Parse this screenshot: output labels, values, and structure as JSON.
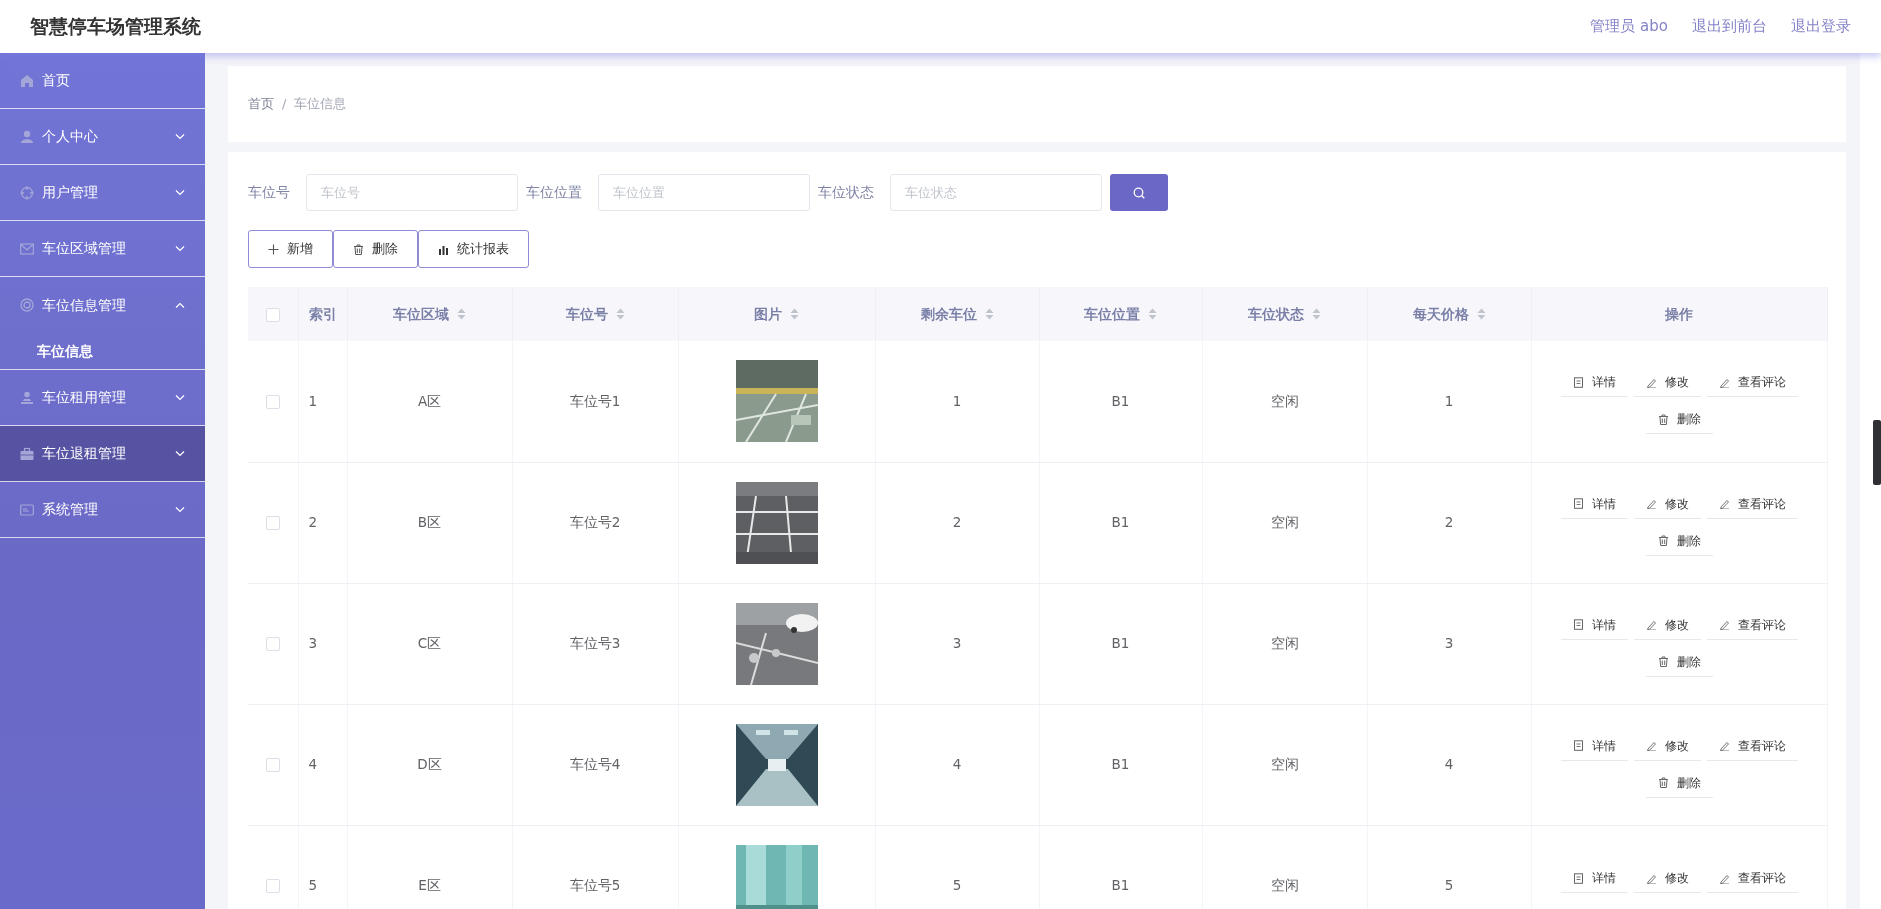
{
  "header": {
    "title": "智慧停车场管理系统",
    "links": [
      "管理员 abo",
      "退出到前台",
      "退出登录"
    ]
  },
  "sidebar": {
    "items": [
      {
        "label": "首页",
        "kind": "link",
        "hovered": false
      },
      {
        "label": "个人中心",
        "kind": "menu",
        "expanded": false,
        "hovered": false
      },
      {
        "label": "用户管理",
        "kind": "menu",
        "expanded": false,
        "hovered": false
      },
      {
        "label": "车位区域管理",
        "kind": "menu",
        "expanded": false,
        "hovered": false
      },
      {
        "label": "车位信息管理",
        "kind": "menu",
        "expanded": true,
        "hovered": false,
        "children": [
          {
            "label": "车位信息",
            "selected": true
          }
        ]
      },
      {
        "label": "车位租用管理",
        "kind": "menu",
        "expanded": false,
        "hovered": false
      },
      {
        "label": "车位退租管理",
        "kind": "menu",
        "expanded": false,
        "hovered": true
      },
      {
        "label": "系统管理",
        "kind": "menu",
        "expanded": false,
        "hovered": false
      }
    ]
  },
  "breadcrumb": {
    "items": [
      "首页",
      "车位信息"
    ],
    "separator": "/"
  },
  "search": {
    "fields": [
      {
        "label": "车位号",
        "placeholder": "车位号"
      },
      {
        "label": "车位位置",
        "placeholder": "车位位置"
      },
      {
        "label": "车位状态",
        "placeholder": "车位状态"
      }
    ]
  },
  "toolbar": [
    {
      "label": "新增",
      "kind": "add"
    },
    {
      "label": "删除",
      "kind": "delete"
    },
    {
      "label": "统计报表",
      "kind": "chart"
    }
  ],
  "table": {
    "select_all_checked": false,
    "columns": [
      {
        "label": "索引",
        "sortable": false
      },
      {
        "label": "车位区域",
        "sortable": true
      },
      {
        "label": "车位号",
        "sortable": true
      },
      {
        "label": "图片",
        "sortable": true
      },
      {
        "label": "剩余车位",
        "sortable": true
      },
      {
        "label": "车位位置",
        "sortable": true
      },
      {
        "label": "车位状态",
        "sortable": true
      },
      {
        "label": "每天价格",
        "sortable": true
      },
      {
        "label": "操作",
        "sortable": false
      }
    ],
    "rows": [
      {
        "checked": false,
        "cells": [
          "1",
          "A区",
          "车位号1",
          "",
          "1",
          "B1",
          "空闲",
          "1"
        ],
        "actions": [
          {
            "label": "详情",
            "kind": "detail"
          },
          {
            "label": "修改",
            "kind": "edit"
          },
          {
            "label": "查看评论",
            "kind": "edit"
          },
          {
            "label": "删除",
            "kind": "delete"
          }
        ]
      },
      {
        "checked": false,
        "cells": [
          "2",
          "B区",
          "车位号2",
          "",
          "2",
          "B1",
          "空闲",
          "2"
        ],
        "actions": [
          {
            "label": "详情",
            "kind": "detail"
          },
          {
            "label": "修改",
            "kind": "edit"
          },
          {
            "label": "查看评论",
            "kind": "edit"
          },
          {
            "label": "删除",
            "kind": "delete"
          }
        ]
      },
      {
        "checked": false,
        "cells": [
          "3",
          "C区",
          "车位号3",
          "",
          "3",
          "B1",
          "空闲",
          "3"
        ],
        "actions": [
          {
            "label": "详情",
            "kind": "detail"
          },
          {
            "label": "修改",
            "kind": "edit"
          },
          {
            "label": "查看评论",
            "kind": "edit"
          },
          {
            "label": "删除",
            "kind": "delete"
          }
        ]
      },
      {
        "checked": false,
        "cells": [
          "4",
          "D区",
          "车位号4",
          "",
          "4",
          "B1",
          "空闲",
          "4"
        ],
        "actions": [
          {
            "label": "详情",
            "kind": "detail"
          },
          {
            "label": "修改",
            "kind": "edit"
          },
          {
            "label": "查看评论",
            "kind": "edit"
          },
          {
            "label": "删除",
            "kind": "delete"
          }
        ]
      },
      {
        "checked": false,
        "cells": [
          "5",
          "E区",
          "车位号5",
          "",
          "5",
          "B1",
          "空闲",
          "5"
        ],
        "actions": [
          {
            "label": "详情",
            "kind": "detail"
          },
          {
            "label": "修改",
            "kind": "edit"
          },
          {
            "label": "查看评论",
            "kind": "edit"
          }
        ]
      }
    ]
  }
}
